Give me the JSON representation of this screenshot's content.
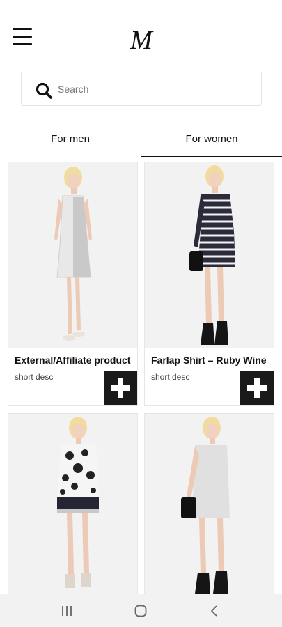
{
  "header": {
    "logo": "M",
    "menu_icon": "hamburger-menu-icon"
  },
  "search": {
    "placeholder": "Search",
    "value": "",
    "icon": "search-icon"
  },
  "tabs": [
    {
      "label": "For men",
      "active": false
    },
    {
      "label": "For women",
      "active": true
    }
  ],
  "products": [
    {
      "title": "External/Affiliate product",
      "desc": "short desc"
    },
    {
      "title": "Farlap Shirt – Ruby Wine",
      "desc": "short desc"
    },
    {
      "title": "",
      "desc": ""
    },
    {
      "title": "",
      "desc": ""
    }
  ],
  "system_nav": {
    "recents_icon": "recents-icon",
    "home_icon": "home-icon",
    "back_icon": "back-icon"
  }
}
